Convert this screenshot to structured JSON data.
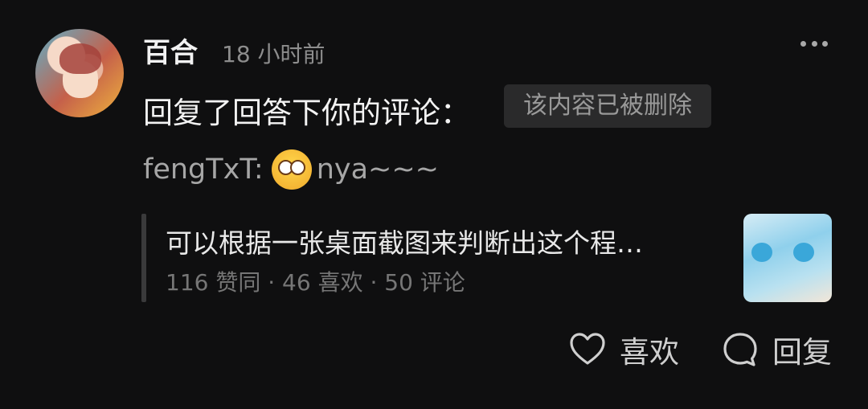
{
  "comment": {
    "username": "百合",
    "time": "18 小时前",
    "reply_text": "回复了回答下你的评论：",
    "deleted_notice": "该内容已被删除",
    "quote_author": "fengTxT:",
    "quote_emoji_icon": "woozy-face-emoji",
    "quote_text": "nya~~~"
  },
  "reference": {
    "title": "可以根据一张桌面截图来判断出这个程…",
    "stats": "116 赞同 · 46 喜欢 · 50 评论"
  },
  "actions": {
    "like_label": "喜欢",
    "reply_label": "回复"
  },
  "icons": {
    "more": "more-horizontal-icon",
    "like": "heart-outline-icon",
    "reply": "comment-bubble-icon"
  }
}
